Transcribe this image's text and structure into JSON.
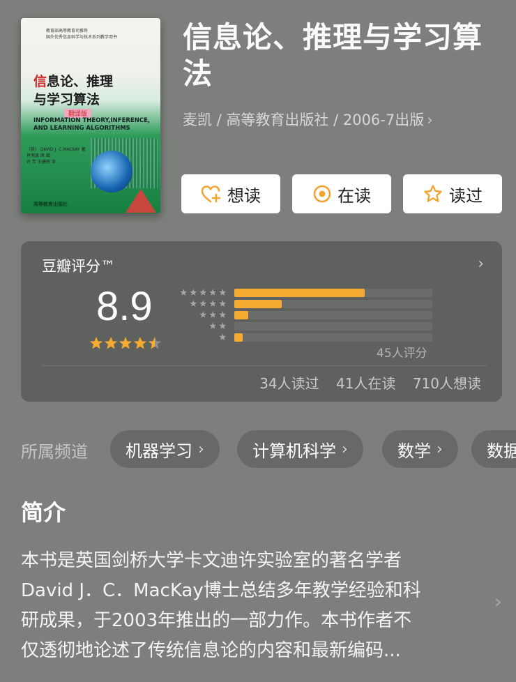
{
  "book": {
    "title": "信息论、推理与学习算法",
    "meta": "麦凯 / 高等教育出版社 / 2006-7出版",
    "cover": {
      "series_line1": "教育部高等教育司推荐",
      "series_line2": "国外优秀信息科学与技术系列教学用书",
      "cn_title_red": "信",
      "cn_title_line1_rest": "息论、推理",
      "cn_title_line2": "与学习算法",
      "edition": "翻译版",
      "en_title": "INFORMATION THEORY,INFERENCE, AND LEARNING ALGORITHMS",
      "authors": "〔英〕 DAVID J. C.MACKAY  著",
      "translators1": "肖明波  席  斌",
      "translators2": "许  芳  王建辉  译",
      "publisher": "高等教育出版社"
    }
  },
  "actions": [
    {
      "label": "想读",
      "icon": "heart-plus-icon"
    },
    {
      "label": "在读",
      "icon": "circle-dot-icon"
    },
    {
      "label": "读过",
      "icon": "star-outline-icon"
    }
  ],
  "rating": {
    "label": "豆瓣评分™",
    "score": "8.9",
    "stars_value": 4.5,
    "distribution": [
      {
        "stars": 5,
        "fraction": 0.66
      },
      {
        "stars": 4,
        "fraction": 0.24
      },
      {
        "stars": 3,
        "fraction": 0.07
      },
      {
        "stars": 2,
        "fraction": 0.0
      },
      {
        "stars": 1,
        "fraction": 0.04
      }
    ],
    "total": "45人评分",
    "read": "34人读过",
    "reading": "41人在读",
    "want": "710人想读",
    "bar_color": "#f6ab33"
  },
  "channels": {
    "label": "所属频道",
    "items": [
      "机器学习",
      "计算机科学",
      "数学",
      "数据"
    ]
  },
  "intro": {
    "heading": "简介",
    "lines": [
      "本书是英国剑桥大学卡文迪许实验室的著名学者",
      "David J．C．MacKay博士总结多年教学经验和科",
      "研成果，于2003年推出的一部力作。本书作者不",
      "仅透彻地论述了传统信息论的内容和最新编码..."
    ]
  }
}
